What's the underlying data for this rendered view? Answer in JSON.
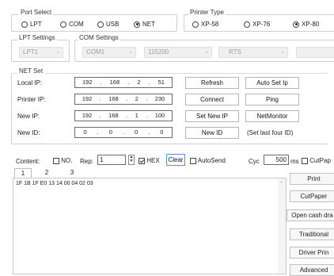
{
  "port_select": {
    "title": "Port Select",
    "options": [
      "LPT",
      "COM",
      "USB",
      "NET"
    ],
    "selected": "NET"
  },
  "printer_type": {
    "title": "Printer Type",
    "options": [
      "XP-58",
      "XP-76",
      "XP-80"
    ],
    "selected": "XP-80"
  },
  "lpt_settings": {
    "title": "LPT Settings",
    "port": "LPT1"
  },
  "com_settings": {
    "title": "COM Settings",
    "port": "COM1",
    "baud": "115200",
    "flow": "RTS",
    "blank": ""
  },
  "net_set": {
    "title": "NET Set",
    "local_ip": {
      "label": "Local IP:",
      "octets": [
        "192",
        "168",
        "2",
        "51"
      ]
    },
    "printer_ip": {
      "label": "Printer IP:",
      "octets": [
        "192",
        "168",
        "2",
        "230"
      ]
    },
    "new_ip": {
      "label": "New IP:",
      "octets": [
        "192",
        "168",
        "1",
        "100"
      ]
    },
    "new_id": {
      "label": "New ID:",
      "octets": [
        "0",
        "0",
        "0",
        "0"
      ]
    },
    "buttons": {
      "refresh": "Refresh",
      "auto_set_ip": "Auto Set Ip",
      "connect": "Connect",
      "ping": "Ping",
      "set_new_ip": "Set New IP",
      "net_monitor": "NetMonitor",
      "new_id": "New ID"
    },
    "hint": "(Set last four ID)"
  },
  "content_bar": {
    "content_label": "Content:",
    "no_label": "NO.",
    "rep_label": "Rep:",
    "rep_value": "1",
    "hex_label": "HEX",
    "hex_checked": true,
    "clear_label": "Clear",
    "autosend_label": "AutoSend",
    "cyc_label": "Cyc",
    "cyc_value": "500",
    "ms_label": "ms",
    "cutpaper_label": "CutPap"
  },
  "tabs": [
    "1",
    "2",
    "3"
  ],
  "editor_text": "1F 1B 1F E0 13 14 00 04 02 03",
  "side_buttons": [
    "Print",
    "CutPaper",
    "Open cash dra",
    "Traditional",
    "Driver Prin",
    "Advanced"
  ]
}
